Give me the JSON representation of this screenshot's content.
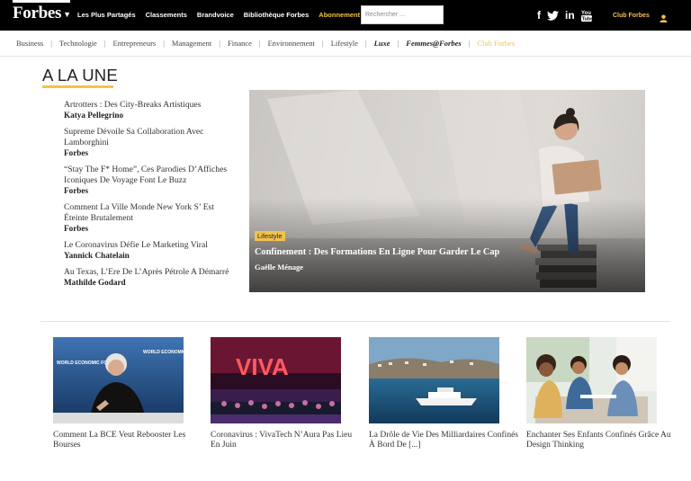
{
  "header": {
    "logo": "Forbes",
    "nav": [
      "Les Plus Partagés",
      "Classements",
      "Brandvoice",
      "Bibliothèque Forbes",
      "Abonnement Magazine"
    ],
    "search_placeholder": "Rechercher ...",
    "social": [
      "facebook-icon",
      "twitter-icon",
      "linkedin-icon",
      "youtube-icon"
    ],
    "club": "Club Forbes"
  },
  "categories": [
    "Business",
    "Technologie",
    "Entrepreneurs",
    "Management",
    "Finance",
    "Environnement",
    "Lifestyle",
    "Luxe",
    "Femmes@Forbes",
    "Club Forbes"
  ],
  "section": {
    "title": "A LA UNE"
  },
  "headlines": [
    {
      "title": "Artrotters : Des City-Breaks Artistiques",
      "author": "Katya Pellegrino"
    },
    {
      "title": "Supreme Dévoile Sa Collaboration Avec Lamborghini",
      "author": "Forbes"
    },
    {
      "title": "“Stay The F* Home”, Ces Parodies D’Affiches Iconiques De Voyage Font Le Buzz",
      "author": "Forbes"
    },
    {
      "title": "Comment La Ville Monde New York S’ Est Éteinte Brutalement",
      "author": "Forbes"
    },
    {
      "title": "Le Coronavirus Défie Le Marketing Viral",
      "author": "Yannick Chatelain"
    },
    {
      "title": "Au Texas, L’Ere De L’Après Pétrole A Démarré",
      "author": "Mathilde Godard"
    }
  ],
  "hero": {
    "badge": "Lifestyle",
    "title": "Confinement : Des Formations En Ligne Pour Garder Le Cap",
    "author": "Gaëlle Ménage"
  },
  "cards": [
    {
      "caption": "Comment La BCE Veut Rebooster Les Bourses"
    },
    {
      "caption": "Coronavirus : VivaTech N’Aura Pas Lieu En Juin"
    },
    {
      "caption": "La Drôle de Vie Des Milliardaires Confinés À Bord De [...]"
    },
    {
      "caption": "Enchanter Ses Enfants Confinés Grâce Au Design Thinking"
    }
  ],
  "card_image_text": {
    "viva": "VIVA",
    "wef": "WORLD ECONOMIC FORUM"
  },
  "colors": {
    "accent": "#f3c24b",
    "topbar": "#000000"
  }
}
